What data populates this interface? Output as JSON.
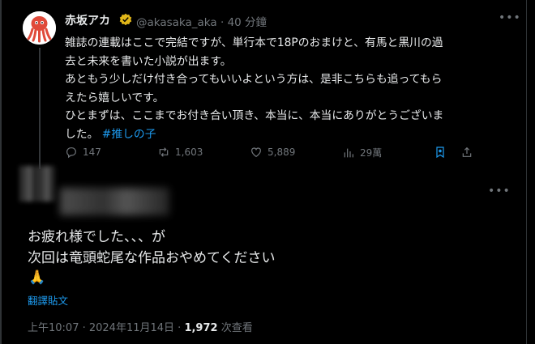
{
  "tweet": {
    "author_name": "赤坂アカ",
    "handle": "@akasaka_aka",
    "time_ago": "40 分鐘",
    "separator": "·",
    "more_icon": "more-horizontal-icon",
    "text": "雑誌の連載はここで完結ですが、単行本で18Pのおまけと、有馬と黒川の過\n去と未来を書いた小説が出ます。\nあともう少しだけ付き合ってもいいよという方は、是非こちらも追ってもら\nえたら嬉しいです。\nひとまずは、ここまでお付き合い頂き、本当に、本当にありがとうございま\nした。",
    "hashtag": "#推しの子",
    "stats": {
      "replies": "147",
      "reposts": "1,603",
      "likes": "5,889",
      "views": "29萬"
    }
  },
  "reply": {
    "text": "お疲れ様でした、、、が\n次回は竜頭蛇尾な作品おやめてください",
    "emoji": "🙏",
    "translate_label": "翻譯貼文",
    "timestamp": "上午10:07 · 2024年11月14日 · ",
    "view_count": "1,972",
    "view_label": " 次查看"
  },
  "colors": {
    "background": "#000000",
    "text_primary": "#e7e9ea",
    "text_secondary": "#71767b",
    "accent_blue": "#1d9bf0",
    "verified_gold": "#e2b719"
  }
}
